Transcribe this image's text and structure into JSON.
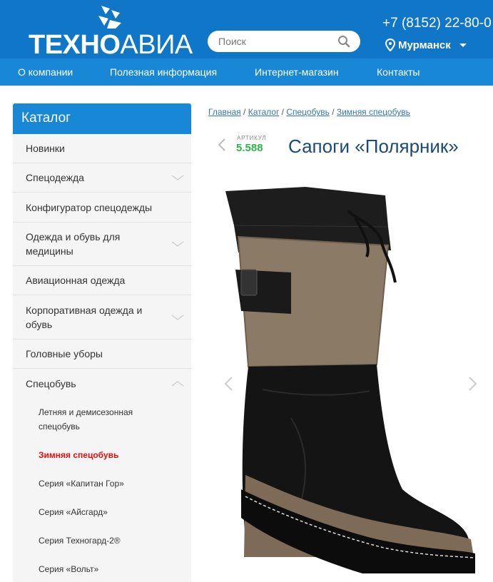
{
  "header": {
    "logo_bold": "ТЕХНО",
    "logo_light": "АВИА",
    "search_placeholder": "Поиск",
    "phone": "+7 (8152) 22-80-0",
    "city": "Мурманск"
  },
  "nav": {
    "items": [
      "О компании",
      "Полезная информация",
      "Интернет-магазин",
      "Контакты"
    ]
  },
  "sidebar": {
    "title": "Каталог",
    "items": [
      "Новинки",
      "Спецодежда",
      "Конфигуратор спецодежды",
      "Одежда и обувь для медицины",
      "Авиационная одежда",
      "Корпоративная одежда и обувь",
      "Головные уборы",
      "Спецобувь"
    ],
    "subitems": [
      "Летняя и демисезонная спецобувь",
      "Зимняя спецобувь",
      "Серия «Капитан Гор»",
      "Серия «Айсгард»",
      "Серия Техногард-2®",
      "Серия «Вольт»"
    ]
  },
  "breadcrumb": {
    "items": [
      "Главная",
      "Каталог",
      "Спецобувь",
      "Зимняя спецобувь"
    ],
    "separator": "/"
  },
  "product": {
    "article_label": "АРТИКУЛ",
    "article": "5.588",
    "title": "Сапоги «Полярник»"
  },
  "colors": {
    "header_bg": "#0f76c8",
    "nav_bg": "#1787d6",
    "active_link": "#e01010",
    "article_green": "#2db54b",
    "title_blue": "#1a4a7a"
  }
}
